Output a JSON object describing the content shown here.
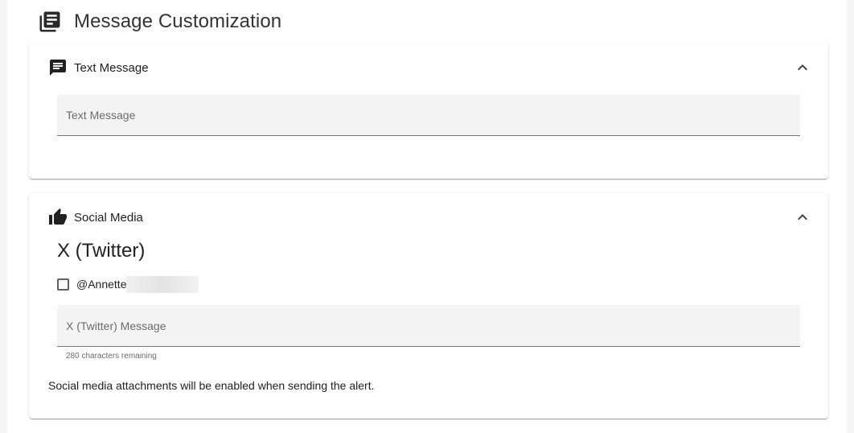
{
  "header": {
    "title": "Message Customization",
    "icon": "library-books-icon"
  },
  "text_message_card": {
    "title": "Text Message",
    "icon": "message-icon",
    "field_placeholder": "Text Message",
    "field_value": ""
  },
  "social_card": {
    "title": "Social Media",
    "icon": "thumb-up-icon",
    "subheading": "X (Twitter)",
    "account_label": "@Annette",
    "account_checked": false,
    "field_placeholder": "X (Twitter) Message",
    "field_value": "",
    "helper_text": "280 characters remaining",
    "note": "Social media attachments will be enabled when sending the alert."
  },
  "colors": {
    "background": "#f5f5f5",
    "card": "#ffffff",
    "field_fill": "#f4f4f4",
    "text": "#212121",
    "muted": "#6b6b6b"
  }
}
